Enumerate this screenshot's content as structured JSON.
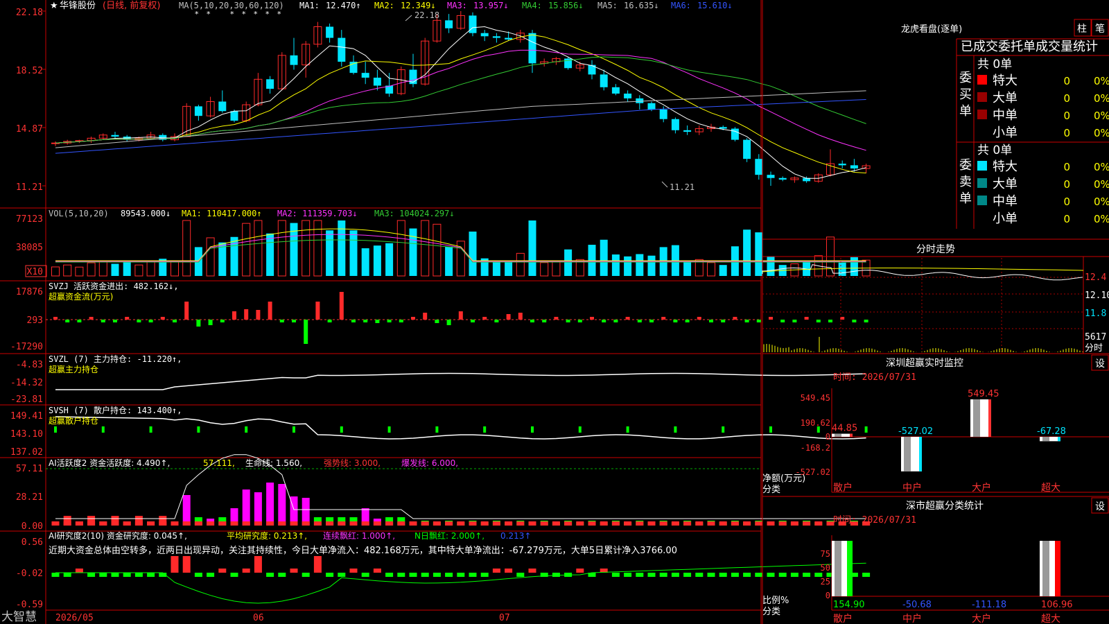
{
  "colors": {
    "up": "#ff2a2a",
    "down": "#00e5ff",
    "ma1": "#ffffff",
    "ma2": "#ffff00",
    "ma3": "#ff33ff",
    "ma4": "#33cc33",
    "ma5": "#c0c0c0",
    "ma6": "#3355ff",
    "grid": "#cc0000",
    "green": "#00ff00",
    "magenta": "#ff00ff",
    "yellow": "#ffff00"
  },
  "header": {
    "star": "★",
    "stock": "华锋股份",
    "mode": "(日线, 前复权)",
    "ma_prefix": "MA(5,10,20,30,60,120)",
    "ma": [
      {
        "k": "MA1:",
        "v": "12.470↑"
      },
      {
        "k": "MA2:",
        "v": "12.349↓"
      },
      {
        "k": "MA3:",
        "v": "13.957↓"
      },
      {
        "k": "MA4:",
        "v": "15.856↓"
      },
      {
        "k": "MA5:",
        "v": "16.635↓"
      },
      {
        "k": "MA6:",
        "v": "15.610↓"
      }
    ],
    "high_label": "22.18",
    "low_label": "11.21"
  },
  "price_axis": [
    "22.18",
    "18.52",
    "14.87",
    "11.21"
  ],
  "vol": {
    "prefix": "VOL(5,10,20)",
    "v": "89543.000↓",
    "ma1": "MA1: 110417.000↑",
    "ma2": "MA2: 111359.703↓",
    "ma3": "MA3: 104024.297↓",
    "axis": [
      "77123",
      "38085",
      "X10"
    ]
  },
  "svzj": {
    "line1": "SVZJ  活跃资金进出: 482.162↓,",
    "line2": "超赢资金流(万元)",
    "axis": [
      "17876",
      "293",
      "-17290"
    ]
  },
  "svzl": {
    "line1": "SVZL (7) 主力持仓: -11.220↑,",
    "line2": "超赢主力持仓",
    "axis": [
      "-4.83",
      "-14.32",
      "-23.81"
    ]
  },
  "svsh": {
    "line1": "SVSH (7) 散户持仓: 143.400↑,",
    "line2": "超赢散户持仓",
    "axis": [
      "149.41",
      "143.10",
      "137.02"
    ]
  },
  "ai1": {
    "p1": "AI活跃度2 资金活跃度: 4.490↑,",
    "p2": "57.111,",
    "p3": "生命线: 1.560,",
    "p4": "强势线: 3.000,",
    "p5": "爆发线: 6.000,",
    "axis": [
      "57.11",
      "28.21",
      "0.00"
    ]
  },
  "ai2": {
    "p1": "AI研究度2(10) 资金研究度: 0.045↑,",
    "p2": "平均研究度: 0.213↑,",
    "p3": "连续飘红: 1.000↑,",
    "p4": "N日飘红: 2.000↑,",
    "p5": "0.213↑",
    "note": "近期大资金总体由空转多，近两日出现异动，关注其持续性，今日大单净流入：482.168万元，其中特大单净流出：-67.279万元，大单5日累计净入3766.00",
    "axis": [
      "0.56",
      "-0.02",
      "-0.59"
    ]
  },
  "dates": [
    "2026/05",
    "06",
    "07"
  ],
  "brand": "大智慧",
  "right": {
    "lhkp": "龙虎看盘(逐单)",
    "btn1": "柱",
    "btn2": "笔",
    "tab": "已成交委托单成交量统计",
    "buy": {
      "side": "委买单",
      "total": "共 0单",
      "rows": [
        [
          "特大",
          "0",
          "0%"
        ],
        [
          "大单",
          "0",
          "0%"
        ],
        [
          "中单",
          "0",
          "0%"
        ],
        [
          "小单",
          "0",
          "0%"
        ]
      ]
    },
    "sell": {
      "side": "委卖单",
      "total": "共 0单",
      "rows": [
        [
          "特大",
          "0",
          "0%"
        ],
        [
          "大单",
          "0",
          "0%"
        ],
        [
          "中单",
          "0",
          "0%"
        ],
        [
          "小单",
          "0",
          "0%"
        ]
      ]
    },
    "fsh": "分时走势",
    "fsh_axis": [
      "12.4",
      "12.10",
      "11.8",
      "5617",
      "分时"
    ],
    "mon": "深圳超赢实时监控",
    "mon_set": "设",
    "mon_time": "时间: 2026/07/31",
    "mon_axis": [
      "549.45",
      "190.62",
      "0",
      "-168.2",
      "-527.02"
    ],
    "mon_ylabel1": "净额(万元)",
    "mon_ylabel2": "分类",
    "mon_labels": [
      "44.85",
      "-527.02",
      "549.45",
      "-67.28"
    ],
    "cls": "深市超赢分类统计",
    "cls_set": "设",
    "cls_time": "时间: 2026/07/31",
    "cls_axis": [
      "75",
      "50",
      "25",
      "0"
    ],
    "cls_ylabel1": "比例%",
    "cls_ylabel2": "分类",
    "cls_labels": [
      "154.90",
      "-50.68",
      "-111.18",
      "106.96"
    ],
    "cats": [
      "散户",
      "中户",
      "大户",
      "超大"
    ]
  },
  "chart_data": [
    {
      "type": "candlestick",
      "title": "华锋股份",
      "ylim": [
        10.5,
        22.5
      ],
      "x": [
        "2026/05",
        "06",
        "07"
      ],
      "ohlc": [
        [
          13.9,
          14.0,
          13.7,
          13.9
        ],
        [
          13.9,
          14.1,
          13.8,
          14.0
        ],
        [
          14.0,
          14.1,
          13.9,
          14.05
        ],
        [
          14.05,
          14.3,
          13.9,
          14.2
        ],
        [
          14.2,
          14.5,
          14.1,
          14.4
        ],
        [
          14.4,
          14.6,
          14.2,
          14.3
        ],
        [
          14.3,
          14.4,
          14.0,
          14.1
        ],
        [
          14.1,
          14.3,
          14.0,
          14.2
        ],
        [
          14.2,
          14.6,
          14.1,
          14.4
        ],
        [
          14.4,
          14.5,
          14.0,
          14.1
        ],
        [
          14.1,
          14.5,
          14.0,
          14.3
        ],
        [
          14.3,
          16.4,
          14.3,
          16.2
        ],
        [
          16.2,
          16.3,
          15.3,
          15.6
        ],
        [
          15.6,
          16.8,
          15.5,
          16.5
        ],
        [
          16.5,
          17.2,
          15.8,
          15.9
        ],
        [
          15.9,
          16.0,
          15.2,
          15.3
        ],
        [
          15.3,
          16.5,
          15.2,
          16.3
        ],
        [
          16.3,
          18.3,
          16.2,
          17.9
        ],
        [
          17.9,
          18.1,
          17.0,
          17.3
        ],
        [
          17.3,
          19.6,
          17.2,
          19.4
        ],
        [
          19.4,
          20.5,
          18.5,
          18.8
        ],
        [
          18.8,
          20.3,
          18.0,
          20.1
        ],
        [
          20.1,
          21.5,
          19.9,
          21.2
        ],
        [
          21.2,
          21.4,
          20.2,
          20.5
        ],
        [
          20.5,
          21.0,
          18.7,
          19.0
        ],
        [
          19.0,
          19.4,
          18.2,
          18.3
        ],
        [
          18.3,
          19.0,
          17.6,
          18.0
        ],
        [
          18.0,
          18.5,
          17.2,
          17.5
        ],
        [
          17.5,
          18.3,
          16.8,
          17.0
        ],
        [
          17.0,
          18.7,
          16.9,
          18.5
        ],
        [
          18.5,
          19.5,
          17.4,
          17.6
        ],
        [
          17.6,
          20.5,
          17.5,
          20.3
        ],
        [
          20.3,
          22.0,
          20.2,
          21.6
        ],
        [
          21.6,
          22.0,
          20.8,
          21.1
        ],
        [
          21.1,
          22.18,
          21.0,
          21.9
        ],
        [
          21.9,
          22.1,
          20.6,
          20.8
        ],
        [
          20.8,
          21.0,
          20.3,
          20.6
        ],
        [
          20.6,
          20.8,
          20.2,
          20.5
        ],
        [
          20.5,
          20.9,
          20.3,
          20.4
        ],
        [
          20.4,
          21.0,
          20.2,
          20.8
        ],
        [
          20.8,
          21.0,
          18.3,
          18.9
        ],
        [
          18.9,
          19.2,
          18.7,
          19.0
        ],
        [
          19.0,
          19.3,
          18.8,
          19.2
        ],
        [
          19.2,
          19.3,
          18.5,
          18.6
        ],
        [
          18.6,
          19.0,
          18.4,
          18.8
        ],
        [
          18.8,
          19.1,
          17.9,
          18.2
        ],
        [
          18.2,
          18.5,
          17.2,
          17.4
        ],
        [
          17.4,
          17.6,
          16.9,
          17.0
        ],
        [
          17.0,
          17.2,
          16.5,
          16.7
        ],
        [
          16.7,
          16.9,
          16.0,
          16.4
        ],
        [
          16.4,
          16.5,
          15.9,
          16.0
        ],
        [
          16.0,
          16.2,
          15.2,
          15.4
        ],
        [
          15.4,
          15.5,
          14.5,
          14.7
        ],
        [
          14.7,
          15.0,
          14.4,
          14.6
        ],
        [
          14.6,
          15.0,
          14.4,
          14.8
        ],
        [
          14.8,
          15.1,
          14.6,
          14.9
        ],
        [
          14.9,
          15.0,
          14.7,
          14.8
        ],
        [
          14.8,
          14.9,
          14.0,
          14.1
        ],
        [
          14.1,
          14.2,
          12.7,
          12.9
        ],
        [
          12.9,
          13.2,
          11.6,
          11.9
        ],
        [
          11.9,
          12.1,
          11.21,
          11.7
        ],
        [
          11.7,
          11.8,
          11.5,
          11.6
        ],
        [
          11.6,
          11.8,
          11.4,
          11.7
        ],
        [
          11.7,
          11.8,
          11.4,
          11.5
        ],
        [
          11.5,
          12.0,
          11.4,
          11.9
        ],
        [
          11.9,
          13.5,
          11.8,
          12.6
        ],
        [
          12.6,
          12.8,
          12.3,
          12.5
        ],
        [
          12.5,
          12.9,
          12.1,
          12.3
        ],
        [
          12.3,
          12.6,
          12.0,
          12.47
        ]
      ]
    },
    {
      "type": "bar",
      "title": "深圳超赢实时监控",
      "categories": [
        "散户",
        "中户",
        "大户",
        "超大"
      ],
      "values": [
        44.85,
        -527.02,
        549.45,
        -67.28
      ],
      "ylabel": "净额(万元)",
      "ylim": [
        -527.02,
        549.45
      ]
    },
    {
      "type": "bar",
      "title": "深市超赢分类统计",
      "categories": [
        "散户",
        "中户",
        "大户",
        "超大"
      ],
      "values": [
        154.9,
        -50.68,
        -111.18,
        106.96
      ],
      "ylabel": "比例%"
    }
  ]
}
